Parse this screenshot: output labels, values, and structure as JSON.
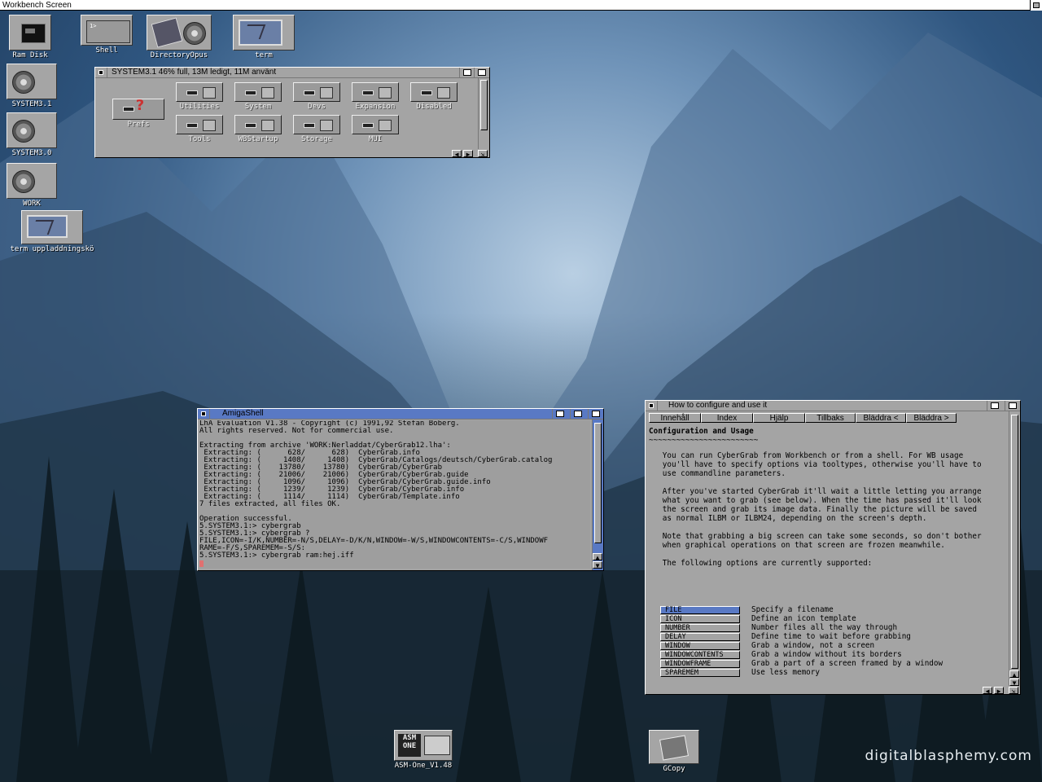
{
  "screen": {
    "title": "Workbench Screen"
  },
  "desktop_icons": [
    {
      "id": "ramdisk",
      "label": "Ram Disk"
    },
    {
      "id": "shell",
      "label": "Shell"
    },
    {
      "id": "dopus",
      "label": "DirectoryOpus"
    },
    {
      "id": "term",
      "label": "term"
    },
    {
      "id": "sys31",
      "label": "SYSTEM3.1"
    },
    {
      "id": "sys30",
      "label": "SYSTEM3.0"
    },
    {
      "id": "work",
      "label": "WORK"
    },
    {
      "id": "termq",
      "label": "term uppladdningskö"
    },
    {
      "id": "asmone",
      "label": "ASM-One_V1.48"
    },
    {
      "id": "gcopy",
      "label": "GCopy"
    }
  ],
  "asmone_logo": "ASM ONE",
  "sys_window": {
    "title": "SYSTEM3.1  46% full, 13M ledigt, 11M använt",
    "drawers": [
      "Prefs",
      "Utilities",
      "System",
      "Devs",
      "Expansion",
      "Disabled",
      "Tools",
      "WBStartup",
      "Storage",
      "MUI"
    ]
  },
  "shell_window": {
    "title": "AmigaShell",
    "lines": [
      "LhA Evaluation V1.38 - Copyright (c) 1991,92 Stefan Boberg.",
      "All rights reserved. Not for commercial use.",
      "",
      "Extracting from archive 'WORK:Nerladdat/CyberGrab12.lha':",
      " Extracting: (      628/      628)  CyberGrab.info",
      " Extracting: (     1408/     1408)  CyberGrab/Catalogs/deutsch/CyberGrab.catalog",
      " Extracting: (    13780/    13780)  CyberGrab/CyberGrab",
      " Extracting: (    21006/    21006)  CyberGrab/CyberGrab.guide",
      " Extracting: (     1096/     1096)  CyberGrab/CyberGrab.guide.info",
      " Extracting: (     1239/     1239)  CyberGrab/CyberGrab.info",
      " Extracting: (     1114/     1114)  CyberGrab/Template.info",
      "7 files extracted, all files OK.",
      "",
      "Operation successful.",
      "5.SYSTEM3.1:> cybergrab",
      "5.SYSTEM3.1:> cybergrab ?",
      "FILE,ICON=-I/K,NUMBER=-N/S,DELAY=-D/K/N,WINDOW=-W/S,WINDOWCONTENTS=-C/S,WINDOWF",
      "RAME=-F/S,SPAREMEM=-S/S:",
      "5.SYSTEM3.1:> cybergrab ram:hej.iff"
    ]
  },
  "guide_window": {
    "title": "How to configure and use it",
    "buttons": [
      "Innehåll",
      "Index",
      "Hjälp",
      "Tillbaks",
      "Bläddra <",
      "Bläddra >"
    ],
    "heading": "Configuration and Usage",
    "underline": "~~~~~~~~~~~~~~~~~~~~~~~~",
    "paragraphs": [
      "   You can run CyberGrab from Workbench or from a shell. For WB usage\n   you'll have to specify options via tooltypes, otherwise you'll have to\n   use commandline parameters.",
      "   After you've started CyberGrab it'll wait a little letting you arrange\n   what you want to grab (see below). When the time has passed it'll look\n   the screen and grab its image data. Finally the picture will be saved\n   as normal ILBM or ILBM24, depending on the screen's depth.",
      "   Note that grabbing a big screen can take some seconds, so don't bother\n   when graphical operations on that screen are frozen meanwhile.",
      "   The following options are currently supported:"
    ],
    "options": [
      {
        "name": "FILE",
        "desc": "Specify a filename"
      },
      {
        "name": "ICON",
        "desc": "Define an icon template"
      },
      {
        "name": "NUMBER",
        "desc": "Number files all the way through"
      },
      {
        "name": "DELAY",
        "desc": "Define time to wait before grabbing"
      },
      {
        "name": "WINDOW",
        "desc": "Grab a window, not a screen"
      },
      {
        "name": "WINDOWCONTENTS",
        "desc": "Grab a window without its borders"
      },
      {
        "name": "WINDOWFRAME",
        "desc": "Grab a part of a screen framed by a window"
      },
      {
        "name": "SPAREMEM",
        "desc": "Use less memory"
      }
    ]
  },
  "watermark": "digitalblasphemy.com"
}
